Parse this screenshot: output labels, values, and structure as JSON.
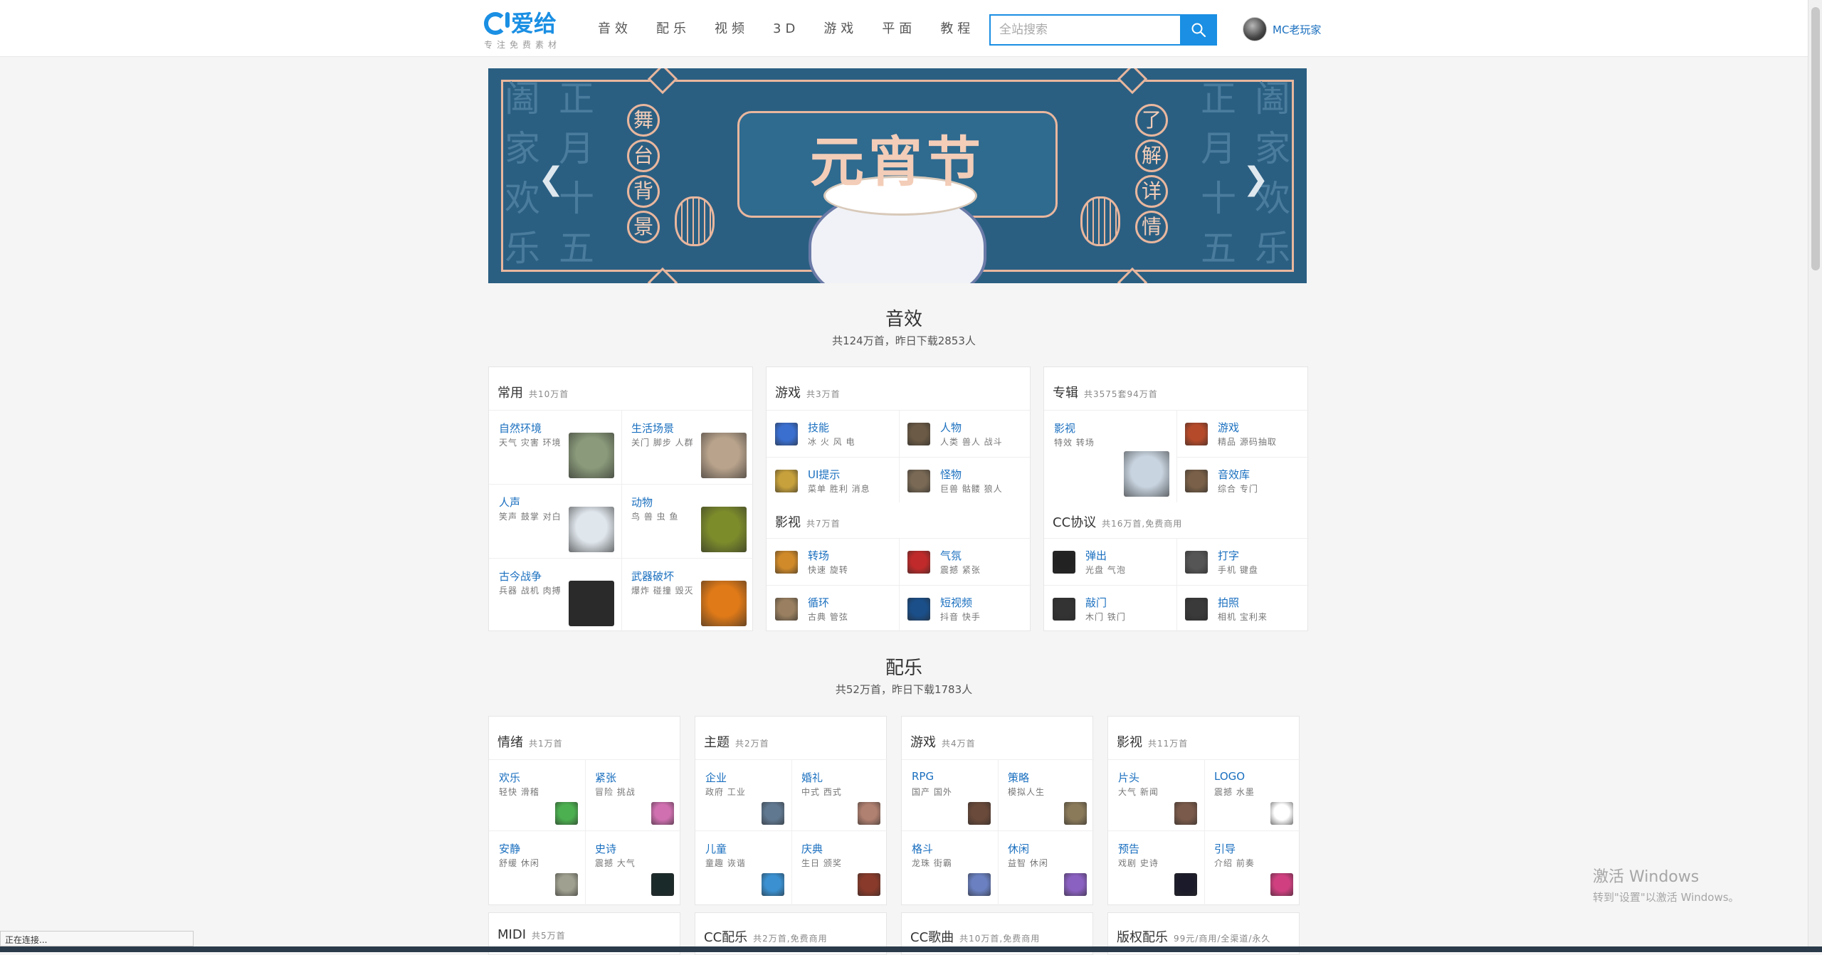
{
  "header": {
    "logo_text": "爱给",
    "logo_tagline": "专注免费素材",
    "nav": [
      "音效",
      "配乐",
      "视频",
      "3D",
      "游戏",
      "平面",
      "教程"
    ],
    "search_placeholder": "全站搜索",
    "username": "MC老玩家"
  },
  "banner": {
    "title": "元宵节",
    "left_badges": [
      "舞",
      "台",
      "背",
      "景"
    ],
    "right_badges": [
      "了",
      "解",
      "详",
      "情"
    ],
    "left_col_outer": "阖家欢乐",
    "left_col_inner": "正月十五",
    "right_col_inner": "正月十五",
    "right_col_outer": "阖家欢乐"
  },
  "sfx": {
    "title": "音效",
    "subtitle": "共124万首，昨日下载2853人",
    "cards": [
      {
        "head": "常用",
        "count": "共10万首",
        "items": [
          {
            "title": "自然环境",
            "sub": "天气 灾害 环境",
            "color": "#8a9a7a"
          },
          {
            "title": "生活场景",
            "sub": "关门 脚步 人群",
            "color": "#b9a38c"
          },
          {
            "title": "人声",
            "sub": "笑声 鼓掌 对白",
            "color": "#dfe6ec"
          },
          {
            "title": "动物",
            "sub": "鸟 兽 虫 鱼",
            "color": "#7d8c2b"
          },
          {
            "title": "古今战争",
            "sub": "兵器 战机 肉搏",
            "color": "#2a2a2a"
          },
          {
            "title": "武器破坏",
            "sub": "爆炸 碰撞 毁灭",
            "color": "#e07a18"
          }
        ]
      },
      {
        "head": "游戏",
        "count": "共3万首",
        "items": [
          {
            "title": "技能",
            "sub": "冰 火 风 电",
            "color": "#3a6fd0"
          },
          {
            "title": "人物",
            "sub": "人类 兽人 战斗",
            "color": "#6b5a45"
          },
          {
            "title": "UI提示",
            "sub": "菜单 胜利 消息",
            "color": "#c7a13b"
          },
          {
            "title": "怪物",
            "sub": "巨兽 骷髅 狼人",
            "color": "#7a6a55"
          }
        ],
        "head2": "影视",
        "count2": "共7万首",
        "items2": [
          {
            "title": "转场",
            "sub": "快速 旋转",
            "color": "#d08a2a"
          },
          {
            "title": "气氛",
            "sub": "震撼 紧张",
            "color": "#c02a2a"
          },
          {
            "title": "循环",
            "sub": "古典 管弦",
            "color": "#9a8060"
          },
          {
            "title": "短视频",
            "sub": "抖音 快手",
            "color": "#1a4f8a"
          }
        ]
      },
      {
        "head": "专辑",
        "count": "共3575套94万首",
        "big": {
          "title": "影视",
          "sub": "特效 转场",
          "color": "#c8d4e0"
        },
        "items": [
          {
            "title": "游戏",
            "sub": "精品 源码抽取",
            "color": "#b54a2a"
          },
          {
            "title": "音效库",
            "sub": "综合 专门",
            "color": "#7a6048"
          }
        ],
        "head2": "CC协议",
        "count2": "共16万首,免费商用",
        "items2": [
          {
            "title": "弹出",
            "sub": "光盘 气泡",
            "color": "#222"
          },
          {
            "title": "打字",
            "sub": "手机 键盘",
            "color": "#555"
          },
          {
            "title": "敲门",
            "sub": "木门 铁门",
            "color": "#333"
          },
          {
            "title": "拍照",
            "sub": "相机 宝利来",
            "color": "#3a3a3a"
          }
        ]
      }
    ]
  },
  "music": {
    "title": "配乐",
    "subtitle": "共52万首，昨日下载1783人",
    "cards": [
      {
        "head": "情绪",
        "count": "共1万首",
        "items": [
          {
            "title": "欢乐",
            "sub": "轻快 滑稽",
            "color": "#4caf50"
          },
          {
            "title": "紧张",
            "sub": "冒险 挑战",
            "color": "#d070b0"
          },
          {
            "title": "安静",
            "sub": "舒缓 休闲",
            "color": "#a0a090"
          },
          {
            "title": "史诗",
            "sub": "震撼 大气",
            "color": "#1a2a2a"
          }
        ]
      },
      {
        "head": "主题",
        "count": "共2万首",
        "items": [
          {
            "title": "企业",
            "sub": "政府 工业",
            "color": "#607890"
          },
          {
            "title": "婚礼",
            "sub": "中式 西式",
            "color": "#b08070"
          },
          {
            "title": "儿童",
            "sub": "童趣 诙谐",
            "color": "#3a90d0"
          },
          {
            "title": "庆典",
            "sub": "生日 颁奖",
            "color": "#8a3a2a"
          }
        ]
      },
      {
        "head": "游戏",
        "count": "共4万首",
        "items": [
          {
            "title": "RPG",
            "sub": "国产 国外",
            "color": "#6a4a3a"
          },
          {
            "title": "策略",
            "sub": "模拟人生",
            "color": "#8a7a5a"
          },
          {
            "title": "格斗",
            "sub": "龙珠 街霸",
            "color": "#6a80c0"
          },
          {
            "title": "休闲",
            "sub": "益智 休闲",
            "color": "#8a60c0"
          }
        ]
      },
      {
        "head": "影视",
        "count": "共11万首",
        "items": [
          {
            "title": "片头",
            "sub": "大气 新闻",
            "color": "#7a5a4a"
          },
          {
            "title": "LOGO",
            "sub": "震撼 水墨",
            "color": "#ffffff"
          },
          {
            "title": "预告",
            "sub": "戏剧 史诗",
            "color": "#1a1a2a"
          },
          {
            "title": "引导",
            "sub": "介绍 前奏",
            "color": "#d04080"
          }
        ]
      }
    ],
    "bottom_heads": [
      {
        "head": "MIDI",
        "count": "共5万首"
      },
      {
        "head": "CC配乐",
        "count": "共2万首,免费商用"
      },
      {
        "head": "CC歌曲",
        "count": "共10万首,免费商用"
      },
      {
        "head": "版权配乐",
        "count": "99元/商用/全渠道/永久"
      }
    ]
  },
  "status_text": "正在连接...",
  "watermark": {
    "line1": "激活 Windows",
    "line2": "转到\"设置\"以激活 Windows。"
  }
}
